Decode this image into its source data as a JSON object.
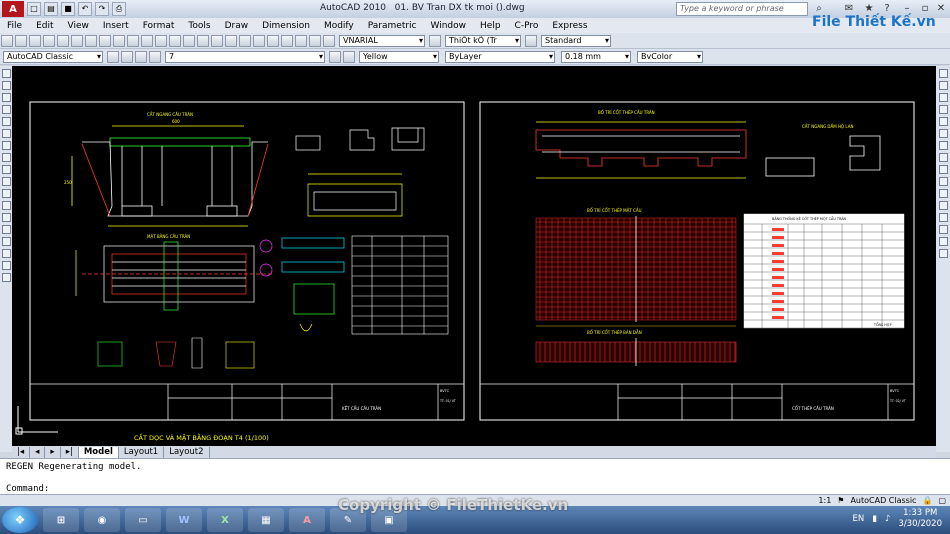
{
  "titlebar": {
    "app_name": "AutoCAD 2010",
    "file_name": "01. BV Tran DX tk moi ().dwg",
    "search_placeholder": "Type a keyword or phrase",
    "brand": "File Thiết Kế.vn"
  },
  "menu": [
    "File",
    "Edit",
    "View",
    "Insert",
    "Format",
    "Tools",
    "Draw",
    "Dimension",
    "Modify",
    "Parametric",
    "Window",
    "Help",
    "C-Pro",
    "Express"
  ],
  "toolbar1": {
    "text_style": "VNARIAL",
    "dim_style": "ThiÕt kÕ (Tr",
    "table_style": "Standard"
  },
  "toolbar2": {
    "workspace": "AutoCAD Classic",
    "layer": "7",
    "color": "Yellow",
    "linetype": "ByLayer",
    "lineweight": "0.18 mm",
    "plotstyle": "BvColor"
  },
  "drawing": {
    "sheet1_footer": "KẾT CẤU CẦU TRÀN",
    "sheet2_footer": "CỐT THÉP CẦU TRÀN",
    "sheet_code": "BVTC",
    "sheet1_no": "TT: 01/ VT",
    "sheet2_no": "TT: 02/ VT",
    "bottom_label": "CẮT DỌC VÀ MẶT BẰNG ĐOẠN T4 (1/100)",
    "title_cross": "CẮT NGANG CẦU TRÀN",
    "title_plan": "MẶT BẰNG CẦU TRÀN",
    "title_rebar_long": "BỐ TRÍ CỐT THÉP CẦU TRÀN",
    "title_rebar_plan": "BỐ TRÍ CỐT THÉP MẶT CẦU",
    "title_rebar_section": "BỐ TRÍ CỐT THÉP BẢN DẪN",
    "title_table": "BẢNG THỐNG KÊ CỐT THÉP MỘT CẦU TRÀN",
    "title_beam": "CẮT NGANG DẦM HỘ LAN",
    "table_label": "TỔNG HỢP",
    "dim_top": "600",
    "dim_left": "250"
  },
  "tabs": [
    "Model",
    "Layout1",
    "Layout2"
  ],
  "command": {
    "history": "REGEN Regenerating model.",
    "prompt": "Command:"
  },
  "status": {
    "scale": "1:1",
    "workspace": "AutoCAD Classic"
  },
  "watermark": "Copyright © FileThietKe.vn",
  "taskbar": {
    "language": "EN",
    "time": "1:33 PM",
    "date": "3/30/2020",
    "apps": [
      "W",
      "X",
      "A"
    ]
  },
  "colors": {
    "canvas_bg": "#000000",
    "cad_white": "#ffffff",
    "cad_yellow": "#ffff00",
    "cad_red": "#ff3b30",
    "cad_green": "#33ff33",
    "cad_cyan": "#00e5ff",
    "cad_magenta": "#ff33ff"
  }
}
